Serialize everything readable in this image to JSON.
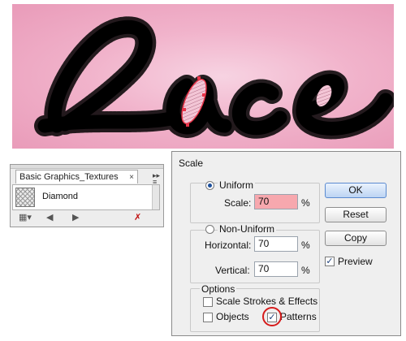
{
  "artwork": {
    "word": "Lace",
    "colors": {
      "background_center": "#f7d3e2",
      "background_edge": "#e99bb9",
      "lettering": "#000000",
      "selection": "#e8354a"
    }
  },
  "swatches_panel": {
    "tab_label": "Basic Graphics_Textures",
    "close_glyph": "×",
    "menu_glyph": "≡",
    "swatch_name": "Diamond",
    "bottom_icons": [
      "library-menu-icon",
      "previous-icon",
      "next-icon",
      "delete-icon"
    ]
  },
  "scale_dialog": {
    "title": "Scale",
    "uniform": {
      "label": "Uniform",
      "selected": true,
      "scale_label": "Scale:",
      "scale_value": "70",
      "unit": "%"
    },
    "non_uniform": {
      "label": "Non-Uniform",
      "selected": false,
      "horizontal_label": "Horizontal:",
      "horizontal_value": "70",
      "vertical_label": "Vertical:",
      "vertical_value": "70",
      "unit": "%"
    },
    "options": {
      "legend": "Options",
      "scale_strokes_label": "Scale Strokes & Effects",
      "scale_strokes_checked": false,
      "objects_label": "Objects",
      "objects_checked": false,
      "patterns_label": "Patterns",
      "patterns_checked": true
    },
    "buttons": {
      "ok": "OK",
      "reset": "Reset",
      "copy": "Copy"
    },
    "preview": {
      "label": "Preview",
      "checked": true
    },
    "check_glyph": "✓",
    "highlight_color": "#f7a8ae"
  }
}
